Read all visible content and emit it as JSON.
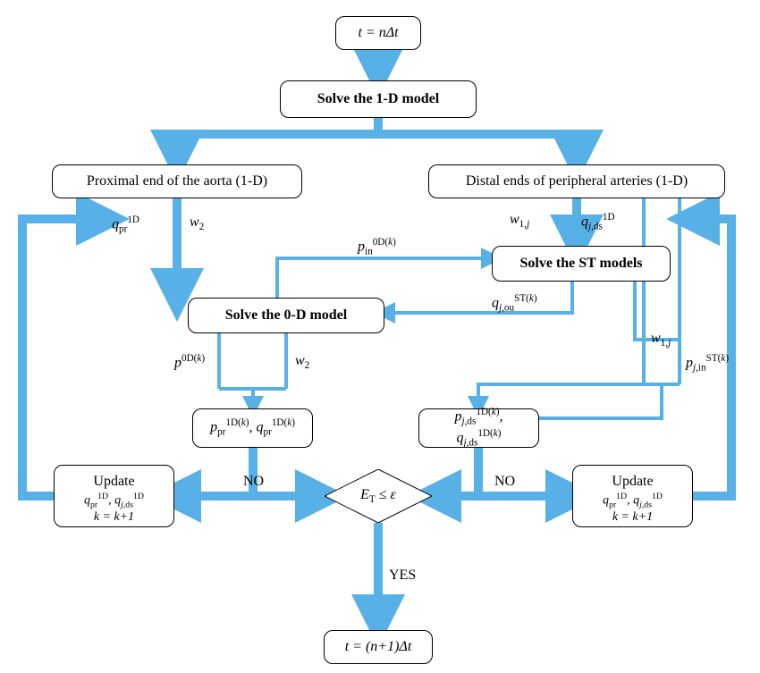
{
  "nodes": {
    "start": "t = nΔt",
    "solve1d": "Solve the 1-D model",
    "prox": "Proximal end of the aorta (1-D)",
    "dist": "Distal ends of peripheral arteries (1-D)",
    "solveST": "Solve the ST models",
    "solve0d": "Solve the 0-D model",
    "update_left": "Update",
    "update_right": "Update",
    "decision": "E_T ≤ ε",
    "end": "t = (n+1)Δt"
  },
  "labels": {
    "prox_out": {
      "q": "q_pr^1D",
      "w": "w_2"
    },
    "dist_out": {
      "w": "w_1,j",
      "q": "q_{j,ds}^1D"
    },
    "p_in": "p_in^{0D(k)}",
    "q_st_out": "q_{j,ou}^{ST(k)}",
    "w1j_down": "w_1,j",
    "p_st_in": "p_{j,in}^{ST(k)}",
    "p0dk": "p^{0D(k)}",
    "w2_down": "w_2",
    "iter_left": {
      "p": "p_pr^{1D(k)}",
      "q": "q_pr^{1D(k)}"
    },
    "iter_right": {
      "p": "p_{j,ds}^{1D(k)}",
      "q": "q_{j,ds}^{1D(k)}"
    },
    "update_left_lines": {
      "a": "q_pr^1D",
      "b": "q_{j,ds}^1D",
      "k": "k = k+1"
    },
    "update_right_lines": {
      "a": "q_pr^1D",
      "b": "q_{j,ds}^1D",
      "k": "k = k+1"
    },
    "no": "NO",
    "yes": "YES"
  },
  "chart_data": {
    "type": "flowchart",
    "nodes": [
      {
        "id": "start",
        "label": "t = nΔt"
      },
      {
        "id": "solve1d",
        "label": "Solve the 1-D model"
      },
      {
        "id": "prox",
        "label": "Proximal end of the aorta (1-D)"
      },
      {
        "id": "dist",
        "label": "Distal ends of peripheral arteries (1-D)"
      },
      {
        "id": "solveST",
        "label": "Solve the ST models"
      },
      {
        "id": "solve0d",
        "label": "Solve the 0-D model"
      },
      {
        "id": "decision",
        "label": "E_T ≤ ε",
        "type": "decision"
      },
      {
        "id": "updateL",
        "label": "Update q_pr^1D, q_{j,ds}^1D; k=k+1"
      },
      {
        "id": "updateR",
        "label": "Update q_pr^1D, q_{j,ds}^1D; k=k+1"
      },
      {
        "id": "end",
        "label": "t = (n+1)Δt"
      }
    ],
    "edges": [
      {
        "from": "start",
        "to": "solve1d"
      },
      {
        "from": "solve1d",
        "to": "prox"
      },
      {
        "from": "solve1d",
        "to": "dist"
      },
      {
        "from": "prox",
        "to": "solve0d",
        "labels": [
          "q_pr^1D",
          "w_2"
        ]
      },
      {
        "from": "dist",
        "to": "solveST",
        "labels": [
          "w_1,j",
          "q_{j,ds}^1D"
        ]
      },
      {
        "from": "solve0d",
        "to": "solveST",
        "label": "p_in^{0D(k)}"
      },
      {
        "from": "solveST",
        "to": "solve0d",
        "label": "q_{j,ou}^{ST(k)}"
      },
      {
        "from": "dist",
        "to": "solveST",
        "label": "w_1,j"
      },
      {
        "from": "solveST",
        "to": "solveST",
        "label": "p_{j,in}^{ST(k)}"
      },
      {
        "from": "solve0d",
        "to": "decision",
        "labels": [
          "p^{0D(k)}",
          "w_2",
          "p_pr^{1D(k)}",
          "q_pr^{1D(k)}"
        ]
      },
      {
        "from": "solveST",
        "to": "decision",
        "labels": [
          "w_1,j",
          "p_{j,in}^{ST(k)}",
          "p_{j,ds}^{1D(k)}",
          "q_{j,ds}^{1D(k)}"
        ]
      },
      {
        "from": "decision",
        "to": "updateL",
        "label": "NO"
      },
      {
        "from": "decision",
        "to": "updateR",
        "label": "NO"
      },
      {
        "from": "updateL",
        "to": "prox"
      },
      {
        "from": "updateR",
        "to": "dist"
      },
      {
        "from": "decision",
        "to": "end",
        "label": "YES"
      }
    ]
  }
}
